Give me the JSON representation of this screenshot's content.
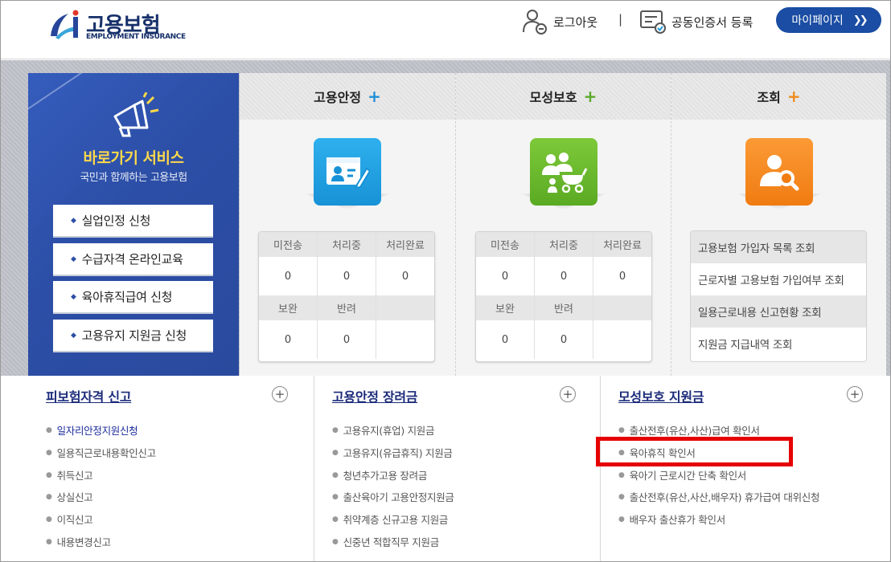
{
  "header": {
    "logo_kr": "고용보험",
    "logo_en": "EMPLOYMENT INSURANCE",
    "logout_label": "로그아웃",
    "separator": "|",
    "cert_label": "공동인증서 등록",
    "mypage_label": "마이페이지"
  },
  "quick": {
    "title": "바로가기 서비스",
    "subtitle": "국민과 함께하는 고용보험",
    "items": [
      "실업인정 신청",
      "수급자격 온라인교육",
      "육아휴직급여 신청",
      "고용유지 지원금 신청"
    ]
  },
  "services": [
    {
      "title": "고용안정",
      "plus_color": "#1e8fd6",
      "icon": "id-card-pen-icon",
      "icon_color": "#1c9be0",
      "headers1": [
        "미전송",
        "처리중",
        "처리완료"
      ],
      "values1": [
        "0",
        "0",
        "0"
      ],
      "headers2": [
        "보완",
        "반려",
        ""
      ],
      "values2": [
        "0",
        "0",
        ""
      ]
    },
    {
      "title": "모성보호",
      "plus_color": "#5aaa2a",
      "icon": "family-stroller-icon",
      "icon_color": "#6bbb2e",
      "headers1": [
        "미전송",
        "처리중",
        "처리완료"
      ],
      "values1": [
        "0",
        "0",
        "0"
      ],
      "headers2": [
        "보완",
        "반려",
        ""
      ],
      "values2": [
        "0",
        "0",
        ""
      ]
    },
    {
      "title": "조회",
      "plus_color": "#f08a1c",
      "icon": "user-search-icon",
      "icon_color": "#f58a1f",
      "lookups": [
        "고용보험 가입자 목록 조회",
        "근로자별 고용보험 가입여부 조회",
        "일용근로내용 신고현황 조회",
        "지원금 지급내역 조회"
      ]
    }
  ],
  "lists": [
    {
      "title": "피보험자격 신고",
      "items": [
        "일자리안정지원신청",
        "일용직근로내용확인신고",
        "취득신고",
        "상실신고",
        "이직신고",
        "내용변경신고"
      ]
    },
    {
      "title": "고용안정 장려금",
      "items": [
        "고용유지(휴업) 지원금",
        "고용유지(유급휴직) 지원금",
        "청년추가고용 장려금",
        "출산육아기 고용안정지원금",
        "취약계층 신규고용 지원금",
        "신중년 적합직무 지원금"
      ]
    },
    {
      "title": "모성보호 지원금",
      "items": [
        "출산전후(유산,사산)급여 확인서",
        "육아휴직 확인서",
        "육아기 근로시간 단축 확인서",
        "출산전후(유산,사산,배우자) 휴가급여 대위신청",
        "배우자 출산휴가 확인서"
      ]
    }
  ],
  "highlight_color": "#e60000"
}
